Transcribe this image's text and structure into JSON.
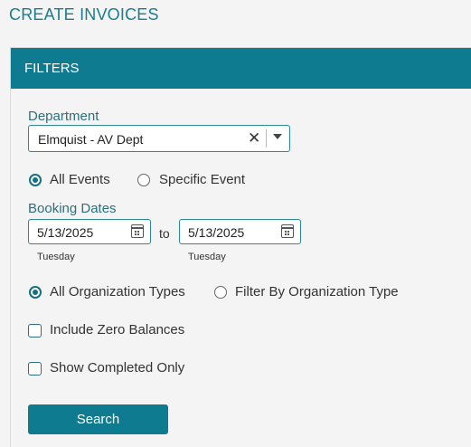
{
  "page": {
    "title": "CREATE INVOICES"
  },
  "filters": {
    "header": "FILTERS",
    "department": {
      "label": "Department",
      "value": "Elmquist - AV Dept",
      "clear_glyph": "✕"
    },
    "event_scope": {
      "options": [
        {
          "label": "All Events",
          "selected": true
        },
        {
          "label": "Specific Event",
          "selected": false
        }
      ]
    },
    "booking_dates": {
      "label": "Booking Dates",
      "from": {
        "value": "5/13/2025",
        "day": "Tuesday"
      },
      "separator": "to",
      "to": {
        "value": "5/13/2025",
        "day": "Tuesday"
      }
    },
    "org_types": {
      "options": [
        {
          "label": "All Organization Types",
          "selected": true
        },
        {
          "label": "Filter By Organization Type",
          "selected": false
        }
      ]
    },
    "include_zero_balances": {
      "label": "Include Zero Balances",
      "checked": false
    },
    "show_completed_only": {
      "label": "Show Completed Only",
      "checked": false
    },
    "search_label": "Search"
  }
}
